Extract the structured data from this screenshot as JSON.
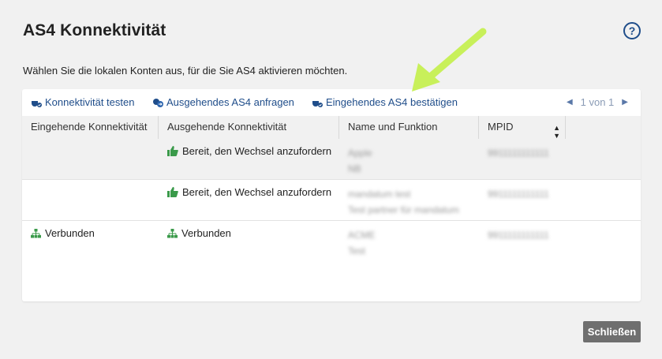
{
  "dialog": {
    "title": "AS4 Konnektivität",
    "help_label": "?",
    "instruction": "Wählen Sie die lokalen Konten aus, für die Sie AS4 aktivieren möchten.",
    "close_label": "Schließen"
  },
  "toolbar": {
    "actions": [
      {
        "label": "Konnektivität testen",
        "icon": "plug-check-icon"
      },
      {
        "label": "Ausgehendes AS4 anfragen",
        "icon": "outgoing-request-icon"
      },
      {
        "label": "Eingehendes AS4 bestätigen",
        "icon": "plug-confirm-icon"
      }
    ],
    "pager": {
      "text": "1 von 1",
      "prev": "◀",
      "next": "▶"
    }
  },
  "table": {
    "columns": [
      "Eingehende Konnektivität",
      "Ausgehende Konnektivität",
      "Name und Funktion",
      "MPID"
    ],
    "sort_icon": "▲▼",
    "rows": [
      {
        "incoming": "",
        "incoming_icon": "",
        "outgoing": "Bereit, den Wechsel anzufordern",
        "outgoing_icon": "thumbs-up-icon",
        "name": "Apple",
        "role": "NB",
        "mpid": "9911111111111"
      },
      {
        "incoming": "",
        "incoming_icon": "",
        "outgoing": "Bereit, den Wechsel anzufordern",
        "outgoing_icon": "thumbs-up-icon",
        "name": "mandatum test",
        "role": "Test partner für mandatum",
        "mpid": "9911111111111"
      },
      {
        "incoming": "Verbunden",
        "incoming_icon": "network-icon",
        "outgoing": "Verbunden",
        "outgoing_icon": "network-icon",
        "name": "ACME",
        "role": "Test",
        "mpid": "9911111111111"
      }
    ]
  },
  "colors": {
    "accent": "#1f4d8a",
    "status_green": "#3a9a4a",
    "arrow": "#c8f05a"
  }
}
